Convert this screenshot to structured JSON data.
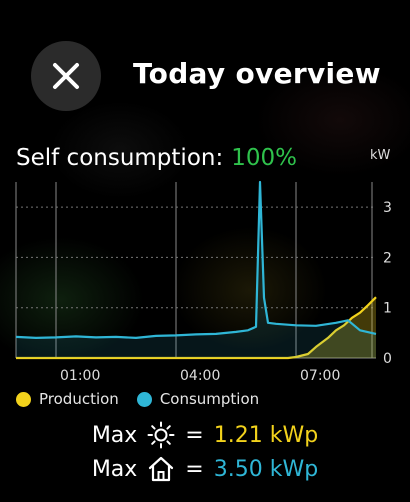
{
  "header": {
    "title": "Today overview",
    "close_icon": "close-icon"
  },
  "self_consumption": {
    "label": "Self consumption:",
    "value": "100%"
  },
  "colors": {
    "production": "#f2d21c",
    "consumption": "#2fb6d6",
    "self_value": "#2fc24c"
  },
  "chart_data": {
    "type": "area",
    "ylabel": "kW",
    "ylim": [
      0,
      3.5
    ],
    "yticks": [
      "0",
      "1",
      "2",
      "3"
    ],
    "xticks": [
      "01:00",
      "04:00",
      "07:00"
    ],
    "x_start_hour": 0,
    "x_end_hour": 9,
    "series": [
      {
        "name": "Production",
        "x": [
          0,
          6.8,
          7.0,
          7.3,
          7.5,
          7.8,
          8.0,
          8.2,
          8.4,
          8.6,
          8.8,
          9.0
        ],
        "values": [
          0,
          0,
          0.02,
          0.08,
          0.22,
          0.4,
          0.55,
          0.65,
          0.8,
          0.9,
          1.05,
          1.21
        ]
      },
      {
        "name": "Consumption",
        "x": [
          0,
          0.5,
          1,
          1.5,
          2,
          2.5,
          3,
          3.5,
          4,
          4.5,
          5,
          5.5,
          5.8,
          6.0,
          6.1,
          6.2,
          6.3,
          6.5,
          7.0,
          7.5,
          8.0,
          8.3,
          8.6,
          9.0
        ],
        "values": [
          0.42,
          0.4,
          0.41,
          0.43,
          0.41,
          0.42,
          0.4,
          0.44,
          0.45,
          0.47,
          0.48,
          0.52,
          0.55,
          0.62,
          3.5,
          1.2,
          0.7,
          0.68,
          0.65,
          0.64,
          0.7,
          0.75,
          0.55,
          0.48
        ]
      }
    ]
  },
  "legend": {
    "production_label": "Production",
    "consumption_label": "Consumption"
  },
  "max_production": {
    "prefix": "Max",
    "icon": "sun-icon",
    "equals": "=",
    "value": "1.21 kWp"
  },
  "max_consumption": {
    "prefix": "Max",
    "icon": "house-icon",
    "equals": "=",
    "value": "3.50 kWp"
  }
}
